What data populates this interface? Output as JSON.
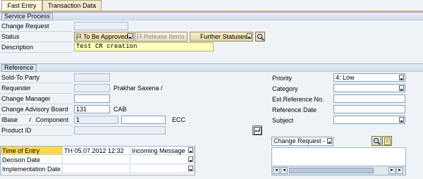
{
  "tabs": [
    {
      "label": "Fast Entry",
      "active": true
    },
    {
      "label": "Transaction Data",
      "active": false
    }
  ],
  "service_process": {
    "title": "Service Process",
    "change_request_label": "Change Request",
    "change_request_value": "",
    "status_label": "Status",
    "status_value": "To Be Approved",
    "release_items_label": "Release Items",
    "further_statuses_label": "Further Statuses",
    "description_label": "Description",
    "description_value": "Test CR creation"
  },
  "reference": {
    "title": "Reference",
    "sold_to_label": "Sold-To Party",
    "sold_to_value": "",
    "requester_label": "Requester",
    "requester_value": "",
    "requester_name": "Prakhar Saxena /",
    "change_manager_label": "Change Manager",
    "change_manager_value": "",
    "cab_label": "Change Advisory Board",
    "cab_value": "131",
    "cab_text": "CAB",
    "ibase_label": "IBase",
    "ibase_sep": "/",
    "component_label": "Component",
    "ibase_value": "1",
    "component_value": "",
    "ecc_text": "ECC",
    "product_label": "Product ID",
    "product_value": "",
    "priority_label": "Priority",
    "priority_value": "4: Low",
    "category_label": "Category",
    "category_value": "",
    "ext_ref_label": "Ext.Reference No.",
    "ext_ref_value": "",
    "ref_date_label": "Reference Date",
    "ref_date_value": "",
    "subject_label": "Subject",
    "subject_value": ""
  },
  "dates": {
    "rows": [
      {
        "label": "Time of Entry",
        "value": "TH 05.07.2012 12:32",
        "type": "Incoming Message"
      },
      {
        "label": "Decison Date",
        "value": "",
        "type": ""
      },
      {
        "label": "Implementation Date",
        "value": "",
        "type": ""
      }
    ]
  },
  "texts": {
    "select_value": "Change Request - I"
  },
  "colors": {
    "background": "#eef3f8",
    "highlight": "#ffd84a",
    "description_field": "#ffffc0"
  }
}
